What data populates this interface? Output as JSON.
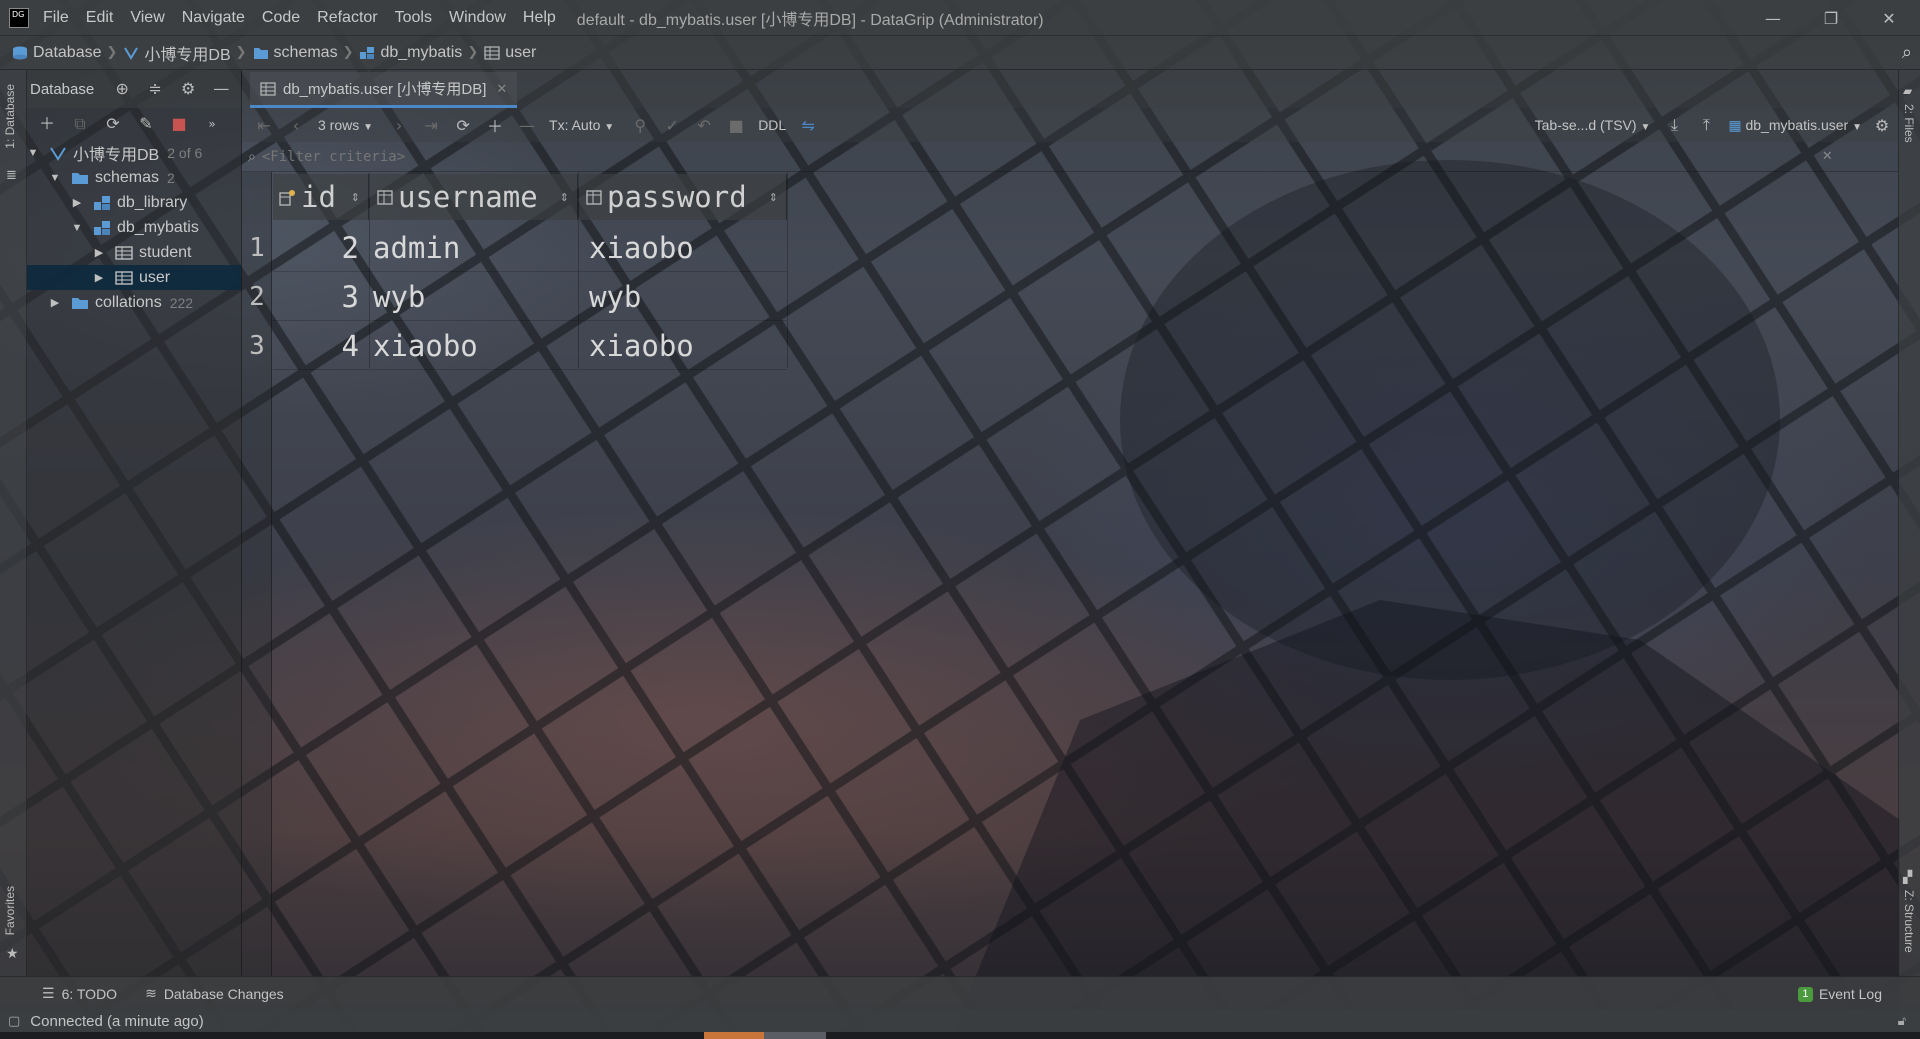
{
  "window": {
    "title": "default - db_mybatis.user [小博专用DB] - DataGrip (Administrator)",
    "menu": [
      "File",
      "Edit",
      "View",
      "Navigate",
      "Code",
      "Refactor",
      "Tools",
      "Window",
      "Help"
    ]
  },
  "breadcrumb": [
    "Database",
    "小博专用DB",
    "schemas",
    "db_mybatis",
    "user"
  ],
  "db_panel": {
    "title": "Database",
    "tree": [
      {
        "label": "小博专用DB",
        "count": "2 of 6",
        "level": 0,
        "expanded": true,
        "icon": "datasource-icon"
      },
      {
        "label": "schemas",
        "count": "2",
        "level": 1,
        "expanded": true,
        "icon": "folder-icon"
      },
      {
        "label": "db_library",
        "count": "",
        "level": 2,
        "expanded": false,
        "icon": "schema-icon"
      },
      {
        "label": "db_mybatis",
        "count": "",
        "level": 2,
        "expanded": true,
        "icon": "schema-icon"
      },
      {
        "label": "student",
        "count": "",
        "level": 3,
        "expanded": false,
        "icon": "table-icon"
      },
      {
        "label": "user",
        "count": "",
        "level": 3,
        "expanded": false,
        "icon": "table-icon",
        "selected": true
      },
      {
        "label": "collations",
        "count": "222",
        "level": 1,
        "expanded": false,
        "icon": "folder-icon"
      }
    ]
  },
  "editor": {
    "tab_label": "db_mybatis.user [小博专用DB]",
    "toolbar": {
      "rows": "3 rows",
      "tx": "Tx: Auto",
      "ddl": "DDL",
      "export_format": "Tab-se...d (TSV)",
      "target": "db_mybatis.user"
    },
    "filter_placeholder": "<Filter criteria>"
  },
  "grid": {
    "columns": [
      "id",
      "username",
      "password"
    ],
    "rows": [
      {
        "num": "1",
        "id": "2",
        "username": "admin",
        "password": "xiaobo"
      },
      {
        "num": "2",
        "id": "3",
        "username": "wyb",
        "password": "wyb"
      },
      {
        "num": "3",
        "id": "4",
        "username": "xiaobo",
        "password": "xiaobo"
      }
    ]
  },
  "side_tabs": {
    "left_top": "1: Database",
    "left_bottom": "Favorites",
    "right_top": "2: Files",
    "right_bottom": "Z: Structure"
  },
  "bottom": {
    "todo": "6: TODO",
    "db_changes": "Database Changes",
    "event_log": "Event Log",
    "event_count": "1",
    "status": "Connected (a minute ago)"
  },
  "colors": {
    "accent": "#4a88c7",
    "selection": "#0d293e",
    "stop": "#c75450",
    "event_badge": "#4c9a3e"
  }
}
